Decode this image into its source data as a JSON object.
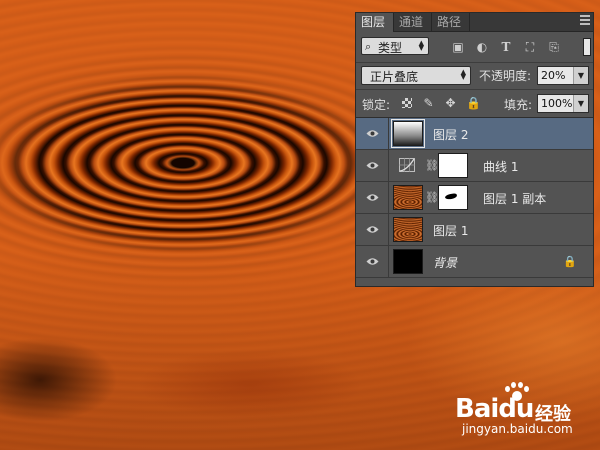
{
  "panel": {
    "tabs": [
      "图层",
      "通道",
      "路径"
    ],
    "active_tab": 0,
    "filter": {
      "kind_label": "类型",
      "icons": [
        "image-filter-icon",
        "adjustment-filter-icon",
        "type-filter-icon",
        "shape-filter-icon",
        "smart-object-filter-icon"
      ]
    },
    "blend_mode": "正片叠底",
    "opacity_label": "不透明度:",
    "opacity_value": "20%",
    "lock_label": "锁定:",
    "lock_icons": [
      "lock-transparent-icon",
      "lock-paint-icon",
      "lock-move-icon",
      "lock-all-icon"
    ],
    "fill_label": "填充:",
    "fill_value": "100%",
    "layers": [
      {
        "name": "图层 2",
        "selected": true,
        "thumb": "gradient"
      },
      {
        "name": "曲线 1",
        "selected": false,
        "thumb": "curves"
      },
      {
        "name": "图层 1 副本",
        "selected": false,
        "thumb": "wood-mask"
      },
      {
        "name": "图层 1",
        "selected": false,
        "thumb": "wood"
      },
      {
        "name": "背景",
        "selected": false,
        "thumb": "black",
        "locked": true
      }
    ]
  },
  "watermark": {
    "logo_part1": "Bai",
    "logo_part2": "du",
    "product": "经验",
    "url": "jingyan.baidu.com"
  },
  "colors": {
    "panel_bg": "#535353",
    "selected_row": "#576a82",
    "artwork_orange": "#d8621a"
  }
}
